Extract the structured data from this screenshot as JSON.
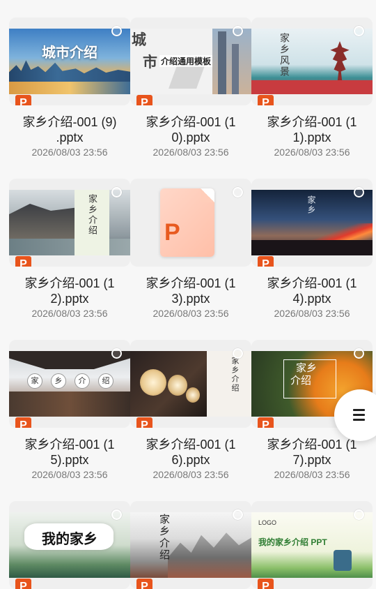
{
  "files": [
    {
      "name": "家乡介绍-001 (9)\n.pptx",
      "date": "2026/08/03 23:56",
      "thumb_text": [
        "城市介绍"
      ]
    },
    {
      "name": "家乡介绍-001 (1\n0).pptx",
      "date": "2026/08/03 23:56",
      "thumb_text": [
        "城",
        "市",
        "介绍通用模板"
      ]
    },
    {
      "name": "家乡介绍-001 (1\n1).pptx",
      "date": "2026/08/03 23:56",
      "thumb_text": [
        "家乡风景"
      ]
    },
    {
      "name": "家乡介绍-001 (1\n2).pptx",
      "date": "2026/08/03 23:56",
      "thumb_text": [
        "家乡介绍"
      ]
    },
    {
      "name": "家乡介绍-001 (1\n3).pptx",
      "date": "2026/08/03 23:56",
      "thumb_text": []
    },
    {
      "name": "家乡介绍-001 (1\n4).pptx",
      "date": "2026/08/03 23:56",
      "thumb_text": [
        "家乡"
      ]
    },
    {
      "name": "家乡介绍-001 (1\n5).pptx",
      "date": "2026/08/03 23:56",
      "thumb_text": [
        "家",
        "乡",
        "介",
        "绍"
      ]
    },
    {
      "name": "家乡介绍-001 (1\n6).pptx",
      "date": "2026/08/03 23:56",
      "thumb_text": [
        "家乡介绍"
      ]
    },
    {
      "name": "家乡介绍-001 (1\n7).pptx",
      "date": "2026/08/03 23:56",
      "thumb_text": [
        "家乡",
        "介绍"
      ]
    },
    {
      "name": "",
      "date": "",
      "thumb_text": [
        "我的家乡"
      ]
    },
    {
      "name": "",
      "date": "",
      "thumb_text": [
        "家乡介绍"
      ]
    },
    {
      "name": "",
      "date": "",
      "thumb_text": [
        "LOGO",
        "我的家乡介绍 PPT"
      ]
    }
  ],
  "file_badge_letter": "P",
  "accent_color": "#e8541c"
}
